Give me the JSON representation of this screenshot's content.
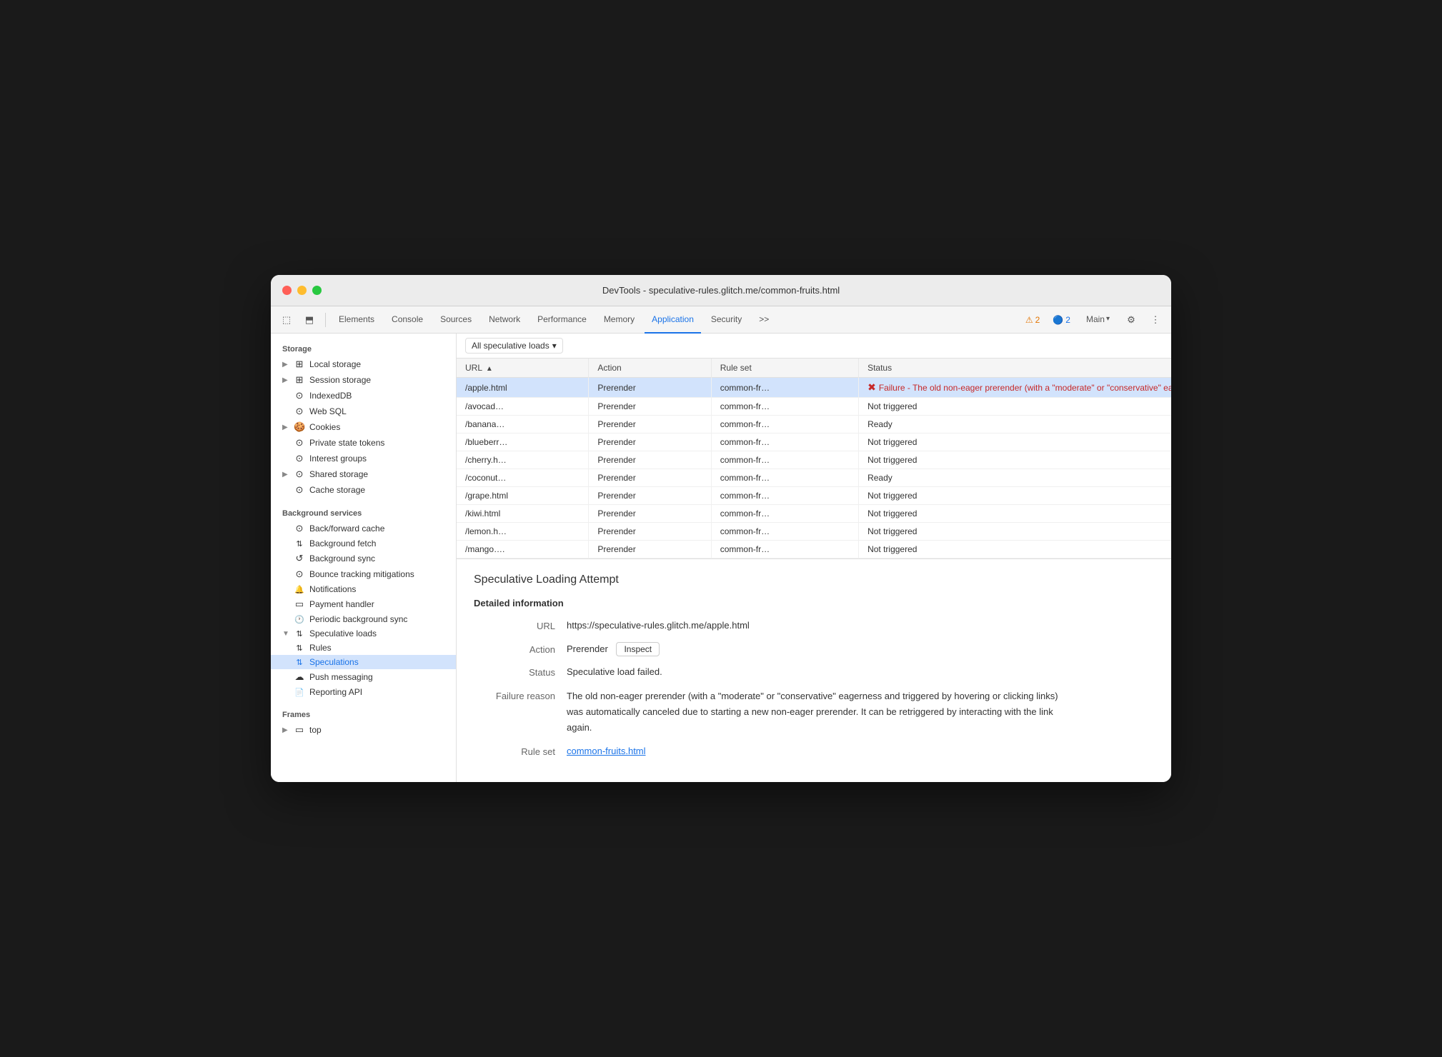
{
  "window": {
    "title": "DevTools - speculative-rules.glitch.me/common-fruits.html"
  },
  "toolbar": {
    "tabs": [
      {
        "id": "elements",
        "label": "Elements",
        "active": false
      },
      {
        "id": "console",
        "label": "Console",
        "active": false
      },
      {
        "id": "sources",
        "label": "Sources",
        "active": false
      },
      {
        "id": "network",
        "label": "Network",
        "active": false
      },
      {
        "id": "performance",
        "label": "Performance",
        "active": false
      },
      {
        "id": "memory",
        "label": "Memory",
        "active": false
      },
      {
        "id": "application",
        "label": "Application",
        "active": true
      },
      {
        "id": "security",
        "label": "Security",
        "active": false
      }
    ],
    "more_label": ">>",
    "warn_count": "2",
    "blue_count": "2",
    "main_label": "Main",
    "settings_icon": "⚙",
    "more_icon": "⋮"
  },
  "sidebar": {
    "storage_title": "Storage",
    "storage_items": [
      {
        "id": "local-storage",
        "label": "Local storage",
        "icon": "⊞",
        "expandable": true
      },
      {
        "id": "session-storage",
        "label": "Session storage",
        "icon": "⊞",
        "expandable": true
      },
      {
        "id": "indexeddb",
        "label": "IndexedDB",
        "icon": "⊙",
        "expandable": false
      },
      {
        "id": "web-sql",
        "label": "Web SQL",
        "icon": "⊙",
        "expandable": false
      },
      {
        "id": "cookies",
        "label": "Cookies",
        "icon": "🍪",
        "expandable": true
      },
      {
        "id": "private-state-tokens",
        "label": "Private state tokens",
        "icon": "⊙",
        "expandable": false
      },
      {
        "id": "interest-groups",
        "label": "Interest groups",
        "icon": "⊙",
        "expandable": false
      },
      {
        "id": "shared-storage",
        "label": "Shared storage",
        "icon": "⊙",
        "expandable": true
      },
      {
        "id": "cache-storage",
        "label": "Cache storage",
        "icon": "⊙",
        "expandable": false
      }
    ],
    "bg_services_title": "Background services",
    "bg_items": [
      {
        "id": "back-forward-cache",
        "label": "Back/forward cache",
        "icon": "⊙"
      },
      {
        "id": "background-fetch",
        "label": "Background fetch",
        "icon": "↑↓"
      },
      {
        "id": "background-sync",
        "label": "Background sync",
        "icon": "↺"
      },
      {
        "id": "bounce-tracking",
        "label": "Bounce tracking mitigations",
        "icon": "⊙"
      },
      {
        "id": "notifications",
        "label": "Notifications",
        "icon": "🔔"
      },
      {
        "id": "payment-handler",
        "label": "Payment handler",
        "icon": "▭"
      },
      {
        "id": "periodic-bg-sync",
        "label": "Periodic background sync",
        "icon": "🕐"
      },
      {
        "id": "speculative-loads",
        "label": "Speculative loads",
        "icon": "↑↓",
        "expandable": true,
        "expanded": true
      },
      {
        "id": "rules",
        "label": "Rules",
        "icon": "↑↓",
        "indented": true
      },
      {
        "id": "speculations",
        "label": "Speculations",
        "icon": "↑↓",
        "indented": true,
        "active": true
      },
      {
        "id": "push-messaging",
        "label": "Push messaging",
        "icon": "☁"
      },
      {
        "id": "reporting-api",
        "label": "Reporting API",
        "icon": "📄"
      }
    ],
    "frames_title": "Frames",
    "frame_items": [
      {
        "id": "top",
        "label": "top",
        "icon": "▭",
        "expandable": true
      }
    ]
  },
  "filter": {
    "label": "All speculative loads",
    "arrow": "▾"
  },
  "table": {
    "columns": [
      {
        "id": "url",
        "label": "URL",
        "sort": "asc"
      },
      {
        "id": "action",
        "label": "Action"
      },
      {
        "id": "rule-set",
        "label": "Rule set"
      },
      {
        "id": "status",
        "label": "Status"
      }
    ],
    "rows": [
      {
        "url": "/apple.html",
        "action": "Prerender",
        "ruleset": "common-fr…",
        "status": "Failure - The old non-eager prerender (with a \"moderate\" or \"conservative\" eagernes",
        "status_error": true,
        "selected": true
      },
      {
        "url": "/avocad…",
        "action": "Prerender",
        "ruleset": "common-fr…",
        "status": "Not triggered",
        "status_error": false
      },
      {
        "url": "/banana…",
        "action": "Prerender",
        "ruleset": "common-fr…",
        "status": "Ready",
        "status_error": false
      },
      {
        "url": "/blueberr…",
        "action": "Prerender",
        "ruleset": "common-fr…",
        "status": "Not triggered",
        "status_error": false
      },
      {
        "url": "/cherry.h…",
        "action": "Prerender",
        "ruleset": "common-fr…",
        "status": "Not triggered",
        "status_error": false
      },
      {
        "url": "/coconut…",
        "action": "Prerender",
        "ruleset": "common-fr…",
        "status": "Ready",
        "status_error": false
      },
      {
        "url": "/grape.html",
        "action": "Prerender",
        "ruleset": "common-fr…",
        "status": "Not triggered",
        "status_error": false
      },
      {
        "url": "/kiwi.html",
        "action": "Prerender",
        "ruleset": "common-fr…",
        "status": "Not triggered",
        "status_error": false
      },
      {
        "url": "/lemon.h…",
        "action": "Prerender",
        "ruleset": "common-fr…",
        "status": "Not triggered",
        "status_error": false
      },
      {
        "url": "/mango….",
        "action": "Prerender",
        "ruleset": "common-fr…",
        "status": "Not triggered",
        "status_error": false
      }
    ]
  },
  "detail": {
    "title": "Speculative Loading Attempt",
    "section_title": "Detailed information",
    "url_label": "URL",
    "url_value": "https://speculative-rules.glitch.me/apple.html",
    "action_label": "Action",
    "action_value": "Prerender",
    "inspect_label": "Inspect",
    "status_label": "Status",
    "status_value": "Speculative load failed.",
    "failure_label": "Failure reason",
    "failure_value": "The old non-eager prerender (with a \"moderate\" or \"conservative\" eagerness and triggered by hovering or clicking links) was automatically canceled due to starting a new non-eager prerender. It can be retriggered by interacting with the link again.",
    "ruleset_label": "Rule set",
    "ruleset_link": "common-fruits.html"
  }
}
